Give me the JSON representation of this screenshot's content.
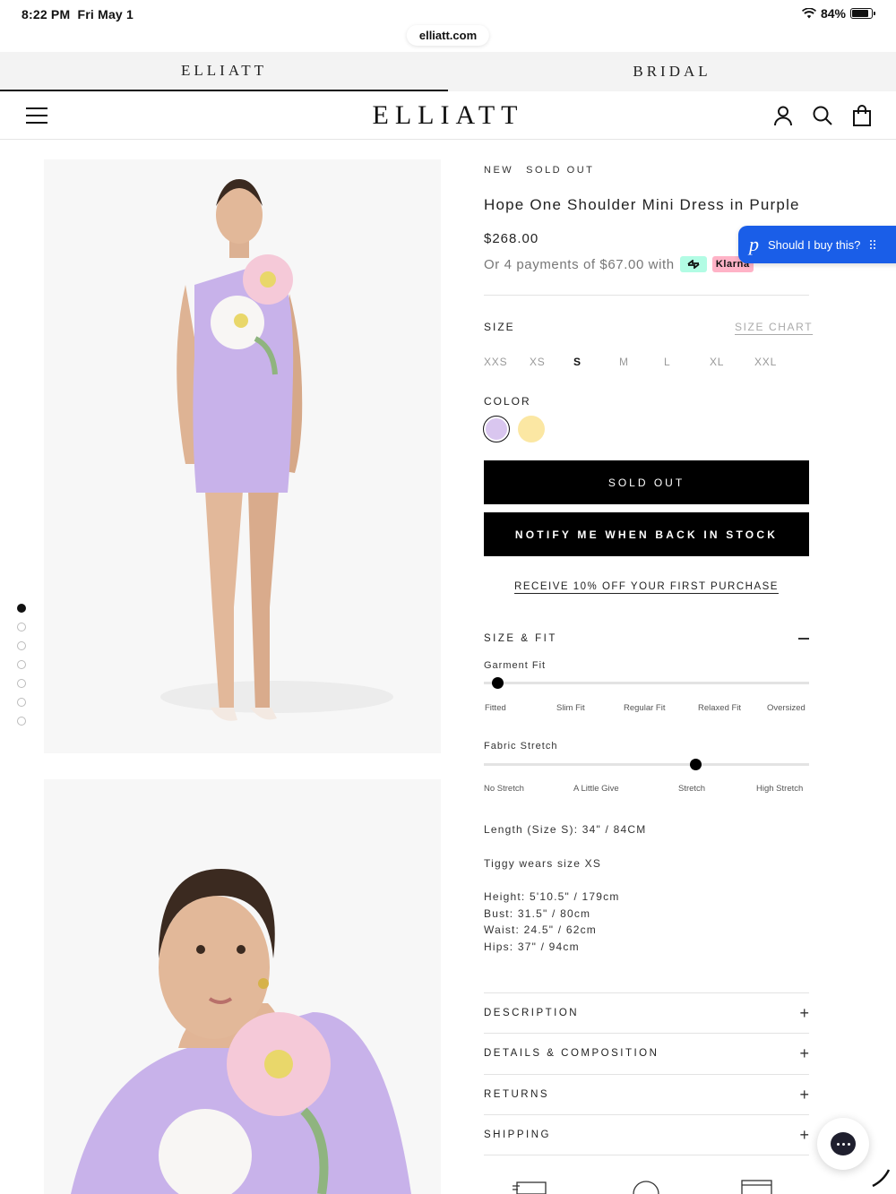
{
  "status": {
    "time": "8:22 PM",
    "date": "Fri May 1",
    "battery": "84%",
    "battery_level": 0.84
  },
  "browser": {
    "url": "elliatt.com"
  },
  "brand_tabs": [
    {
      "label": "ELLIATT",
      "active": true
    },
    {
      "label": "BRIDAL",
      "active": false
    }
  ],
  "header": {
    "logo": "ELLIATT",
    "icons": [
      "menu-icon",
      "account-icon",
      "search-icon",
      "bag-icon"
    ]
  },
  "gallery": {
    "image_count": 7,
    "active_index": 0
  },
  "product": {
    "badges": [
      "NEW",
      "SOLD OUT"
    ],
    "title": "Hope One Shoulder Mini Dress in Purple",
    "price": "$268.00",
    "installments": "Or 4 payments of $67.00 with",
    "klarna_label": "Klarna",
    "size_label": "SIZE",
    "size_chart": "SIZE CHART",
    "sizes": [
      "XXS",
      "XS",
      "S",
      "M",
      "L",
      "XL",
      "XXL"
    ],
    "selected_size": "S",
    "color_label": "COLOR",
    "colors": [
      {
        "name": "Purple",
        "hex": "#d9c6ef",
        "selected": true
      },
      {
        "name": "Yellow",
        "hex": "#fbe7a3",
        "selected": false
      }
    ],
    "sold_out_button": "SOLD OUT",
    "notify_button": "NOTIFY ME WHEN BACK IN STOCK",
    "promo_link": "RECEIVE 10% OFF YOUR FIRST PURCHASE"
  },
  "size_fit": {
    "label": "SIZE & FIT",
    "garment_fit": {
      "label": "Garment Fit",
      "scale": [
        "Fitted",
        "Slim Fit",
        "Regular Fit",
        "Relaxed Fit",
        "Oversized"
      ],
      "value": 0.04
    },
    "fabric_stretch": {
      "label": "Fabric Stretch",
      "scale": [
        "No Stretch",
        "A Little Give",
        "Stretch",
        "High Stretch"
      ],
      "value": 0.65
    },
    "length": "Length (Size S): 34\" / 84CM",
    "model_size": "Tiggy wears size XS",
    "measurements": [
      "Height: 5'10.5\" / 179cm",
      "Bust: 31.5\" / 80cm",
      "Waist: 24.5\" / 62cm",
      "Hips: 37\" / 94cm"
    ]
  },
  "accordions": [
    "DESCRIPTION",
    "DETAILS & COMPOSITION",
    "RETURNS",
    "SHIPPING"
  ],
  "widget": {
    "label": "Should I buy this?",
    "logo": "p"
  },
  "accent": {
    "black": "#000000",
    "widget_blue": "#1a5ee8"
  }
}
